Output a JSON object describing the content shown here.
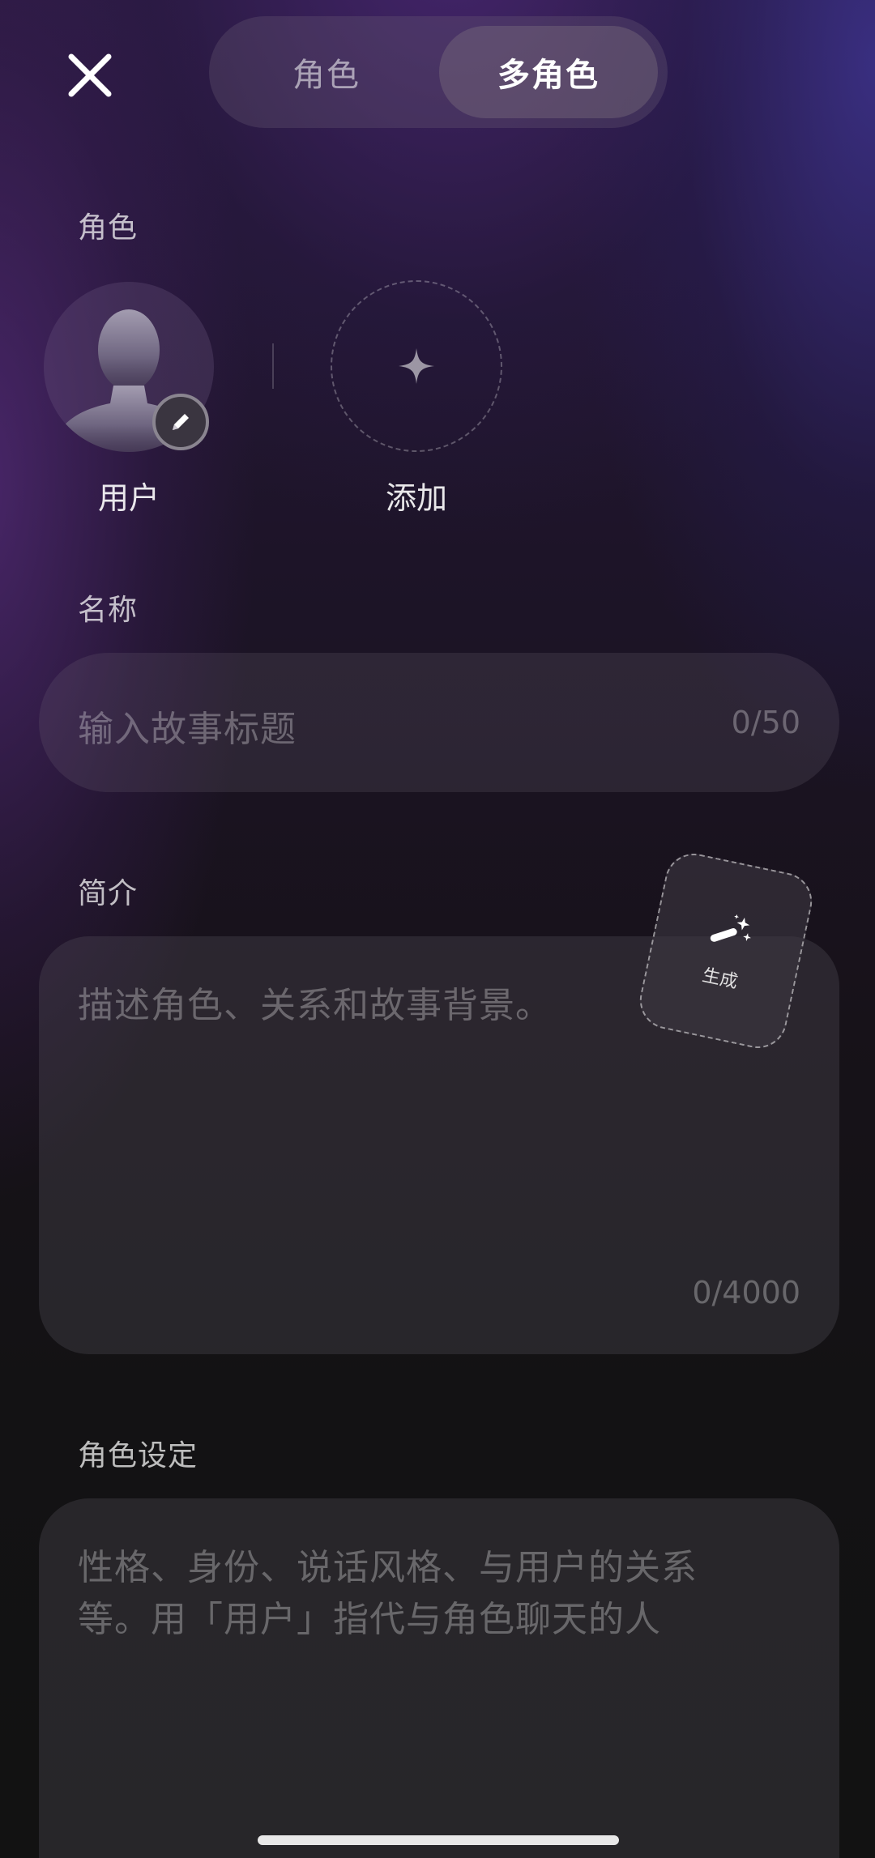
{
  "header": {
    "close_icon": "close-icon",
    "tabs": [
      {
        "label": "角色",
        "active": false
      },
      {
        "label": "多角色",
        "active": true
      }
    ]
  },
  "characters": {
    "section_label": "角色",
    "items": [
      {
        "name": "用户",
        "avatar_icon": "person-silhouette-icon",
        "badge_icon": "pencil-icon"
      }
    ],
    "add_label": "添加",
    "add_icon": "plus-icon"
  },
  "name_field": {
    "label": "名称",
    "placeholder": "输入故事标题",
    "counter": "0/50"
  },
  "intro_field": {
    "label": "简介",
    "placeholder": "描述角色、关系和故事背景。",
    "counter": "0/4000"
  },
  "generate_button": {
    "label": "生成",
    "icon": "magic-wand-icon"
  },
  "persona_field": {
    "label": "角色设定",
    "placeholder_line1": "性格、身份、说话风格、与用户的关系",
    "placeholder_line2": "等。用「用户」指代与角色聊天的人"
  },
  "colors": {
    "accent_text": "#ffffff",
    "muted_text": "#8c8590",
    "field_bg": "#2c2830"
  }
}
